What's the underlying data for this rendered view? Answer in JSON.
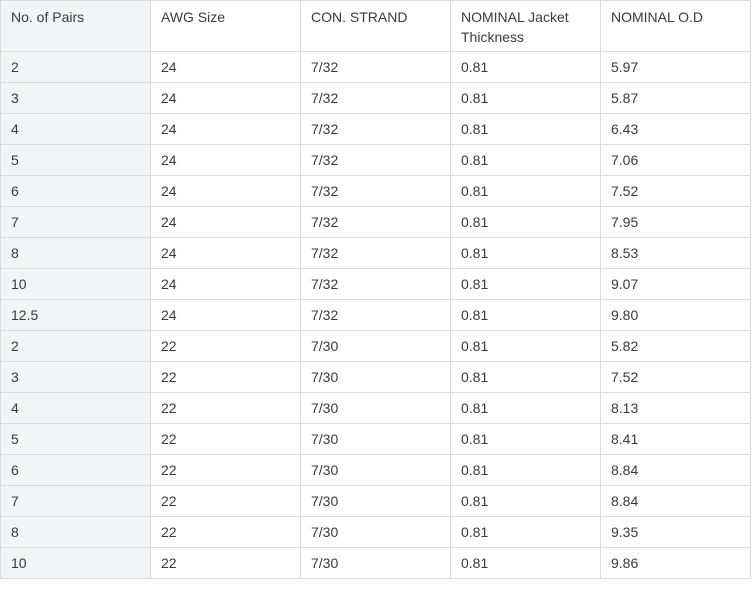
{
  "table": {
    "headers": [
      "No. of Pairs",
      "AWG Size",
      "CON. STRAND",
      "NOMINAL Jacket Thickness",
      "NOMINAL O.D"
    ],
    "rows": [
      [
        "2",
        "24",
        "7/32",
        "0.81",
        "5.97"
      ],
      [
        "3",
        "24",
        "7/32",
        "0.81",
        "5.87"
      ],
      [
        "4",
        "24",
        "7/32",
        "0.81",
        "6.43"
      ],
      [
        "5",
        "24",
        "7/32",
        "0.81",
        "7.06"
      ],
      [
        "6",
        "24",
        "7/32",
        "0.81",
        "7.52"
      ],
      [
        "7",
        "24",
        "7/32",
        "0.81",
        "7.95"
      ],
      [
        "8",
        "24",
        "7/32",
        "0.81",
        "8.53"
      ],
      [
        "10",
        "24",
        "7/32",
        "0.81",
        "9.07"
      ],
      [
        "12.5",
        "24",
        "7/32",
        "0.81",
        "9.80"
      ],
      [
        "2",
        "22",
        "7/30",
        "0.81",
        "5.82"
      ],
      [
        "3",
        "22",
        "7/30",
        "0.81",
        "7.52"
      ],
      [
        "4",
        "22",
        "7/30",
        "0.81",
        "8.13"
      ],
      [
        "5",
        "22",
        "7/30",
        "0.81",
        "8.41"
      ],
      [
        "6",
        "22",
        "7/30",
        "0.81",
        "8.84"
      ],
      [
        "7",
        "22",
        "7/30",
        "0.81",
        "8.84"
      ],
      [
        "8",
        "22",
        "7/30",
        "0.81",
        "9.35"
      ],
      [
        "10",
        "22",
        "7/30",
        "0.81",
        "9.86"
      ]
    ]
  }
}
